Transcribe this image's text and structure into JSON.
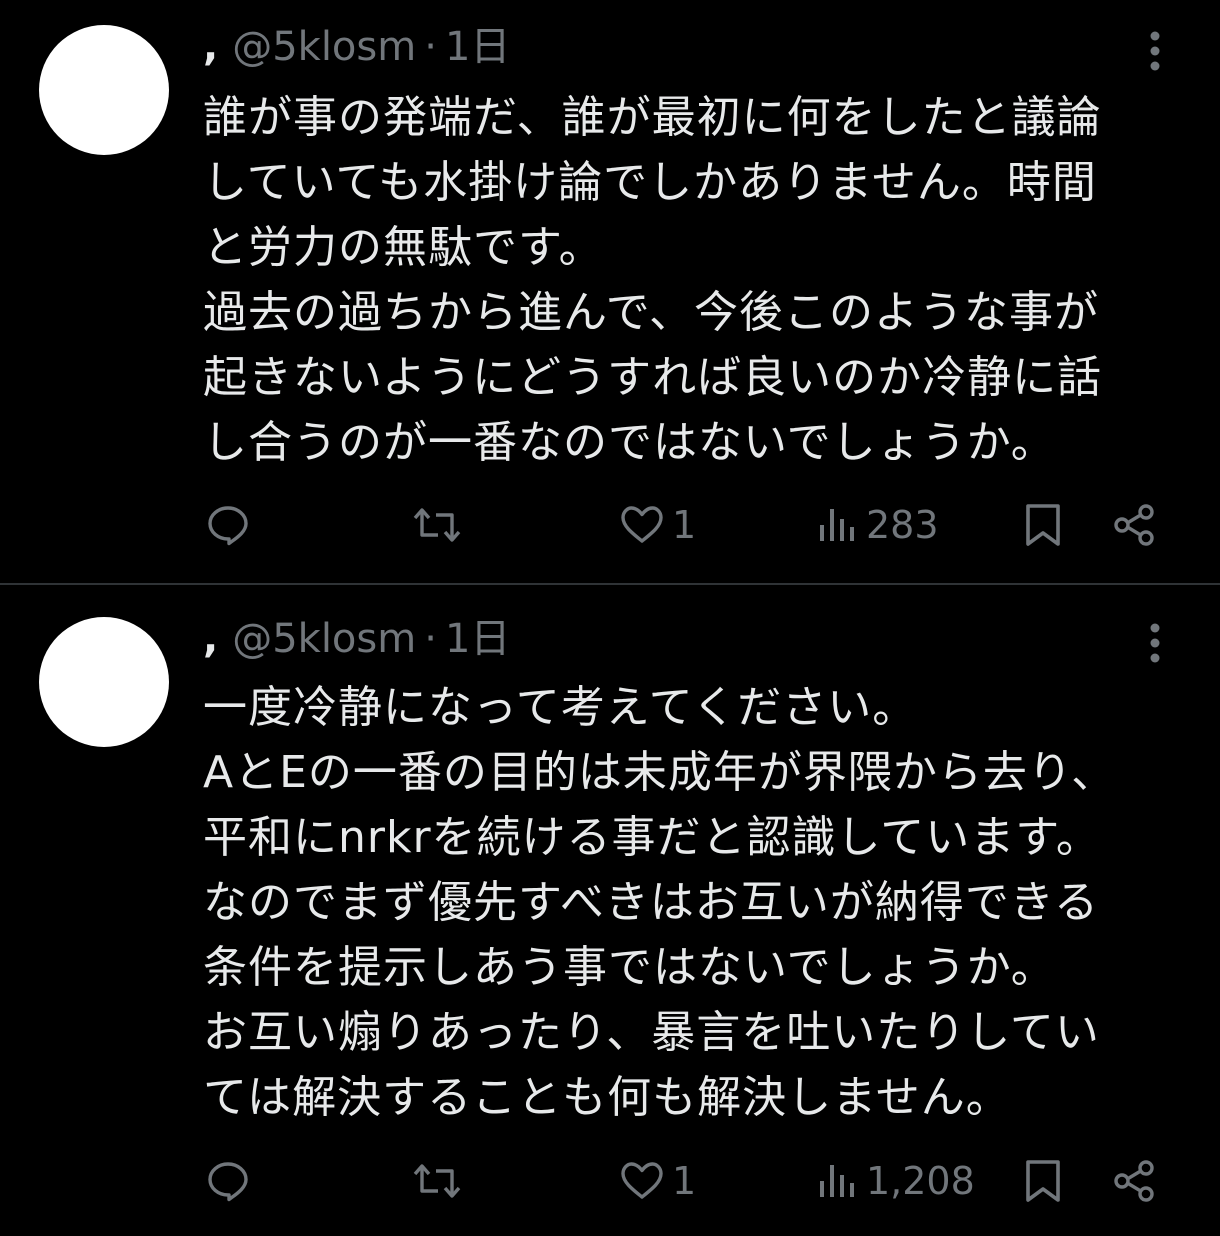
{
  "tweets": [
    {
      "display_name": ",",
      "handle": "@5klosm",
      "separator": "·",
      "time": "1日",
      "text": "誰が事の発端だ、誰が最初に何をしたと議論\nしていても水掛け論でしかありません。時間\nと労力の無駄です。\n過去の過ちから進んで、今後このような事が\n起きないようにどうすれば良いのか冷静に話\nし合うのが一番なのではないでしょうか。",
      "likes": "1",
      "views": "283",
      "icons": [
        "more-icon",
        "reply-icon",
        "repost-icon",
        "like-icon",
        "views-icon",
        "bookmark-icon",
        "share-icon"
      ]
    },
    {
      "display_name": ",",
      "handle": "@5klosm",
      "separator": "·",
      "time": "1日",
      "text": "一度冷静になって考えてください。\nAとEの一番の目的は未成年が界隈から去り、\n平和にnrkrを続ける事だと認識しています。\nなのでまず優先すべきはお互いが納得できる\n条件を提示しあう事ではないでしょうか。\nお互い煽りあったり、暴言を吐いたりしてい\nては解決することも何も解決しません。",
      "likes": "1",
      "views": "1,208",
      "icons": [
        "more-icon",
        "reply-icon",
        "repost-icon",
        "like-icon",
        "views-icon",
        "bookmark-icon",
        "share-icon"
      ]
    }
  ],
  "colors": {
    "background": "#000000",
    "text": "#e7e9ea",
    "muted": "#71767b",
    "divider": "#2f3336",
    "avatar": "#ffffff"
  }
}
